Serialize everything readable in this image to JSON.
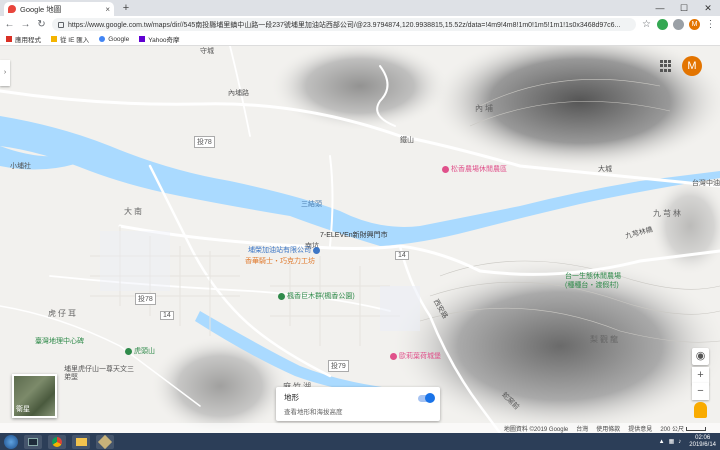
{
  "tab": {
    "title": "Google 地圖",
    "close": "×",
    "new_tab": "+"
  },
  "window": {
    "min": "—",
    "max": "☐",
    "close": "✕"
  },
  "toolbar": {
    "url": "https://www.google.com.tw/maps/dir//545南投縣埔里鎮中山路一段237號埔里加油站西部公司/@23.9794874,120.9938815,15.52z/data=!4m9!4m8!1m0!1m5!1m1!1s0x3468d97c6..."
  },
  "bookmarks": [
    {
      "label": "應用程式",
      "icon": "apps-grid-icon",
      "color": "#d93025"
    },
    {
      "label": "從 IE 匯入",
      "icon": "folder-icon",
      "color": "#f4b400"
    },
    {
      "label": "Google",
      "icon": "google-g-icon",
      "color": "#4285f4"
    },
    {
      "label": "Yahoo奇摩",
      "icon": "yahoo-icon",
      "color": "#6001d2"
    }
  ],
  "profile": {
    "initial": "M"
  },
  "map_labels": {
    "guoshan": "守城",
    "neipu": "內埔",
    "danan": "大南",
    "huzaier": "虎仔耳",
    "jiukongnan": "九芎林",
    "jiukongqiao": "九芎林橋",
    "daocheng": "大城",
    "taiwanzhong": "台灣中油",
    "aidbao": "鐵山",
    "road78": "投78",
    "road79": "投79",
    "road14": "14",
    "sanjie": "三結頭",
    "xiaolin": "小埔社",
    "nanshan": "南坑",
    "west": "西安路",
    "neipu_rd": "內埔路",
    "yidong": "蛇窯前"
  },
  "pois": {
    "songbo": "松香農場休閒農區",
    "seven": "7-ELEVEn新財興門市",
    "gas": "埔榮加油站有限公司",
    "chocolate": "香華騎士‧巧克力工坊",
    "paper": "楓香巨木群(楓香公園)",
    "geo": "臺灣地理中心碑",
    "tiger": "虎頭山",
    "temple": "埔里虎仔山一尊天文三弟堅",
    "flower": "歐莉葉荷城堡",
    "farm": "台一生態休閒農場",
    "farm2": "(種種台‧渡假村)",
    "bamboo": "麻竹湖",
    "huilin": "梨觀龍"
  },
  "layer": {
    "label": "衛星"
  },
  "terrain": {
    "title": "地形",
    "subtitle": "查看地形和海拔高度",
    "enabled": true
  },
  "controls": {
    "zoom_in": "+",
    "zoom_out": "−",
    "locate": "◉"
  },
  "footer": {
    "attribution": "地圖資料 ©2019 Google",
    "region": "台灣",
    "terms": "使用條款",
    "feedback": "提供意見",
    "scale": "200 公尺"
  },
  "taskbar": {
    "time": "02:06",
    "date": "2019/6/14"
  },
  "colors": {
    "water": "#aadaff",
    "road": "#ffffff",
    "accent": "#1a73e8",
    "poi": "#e0508a"
  }
}
